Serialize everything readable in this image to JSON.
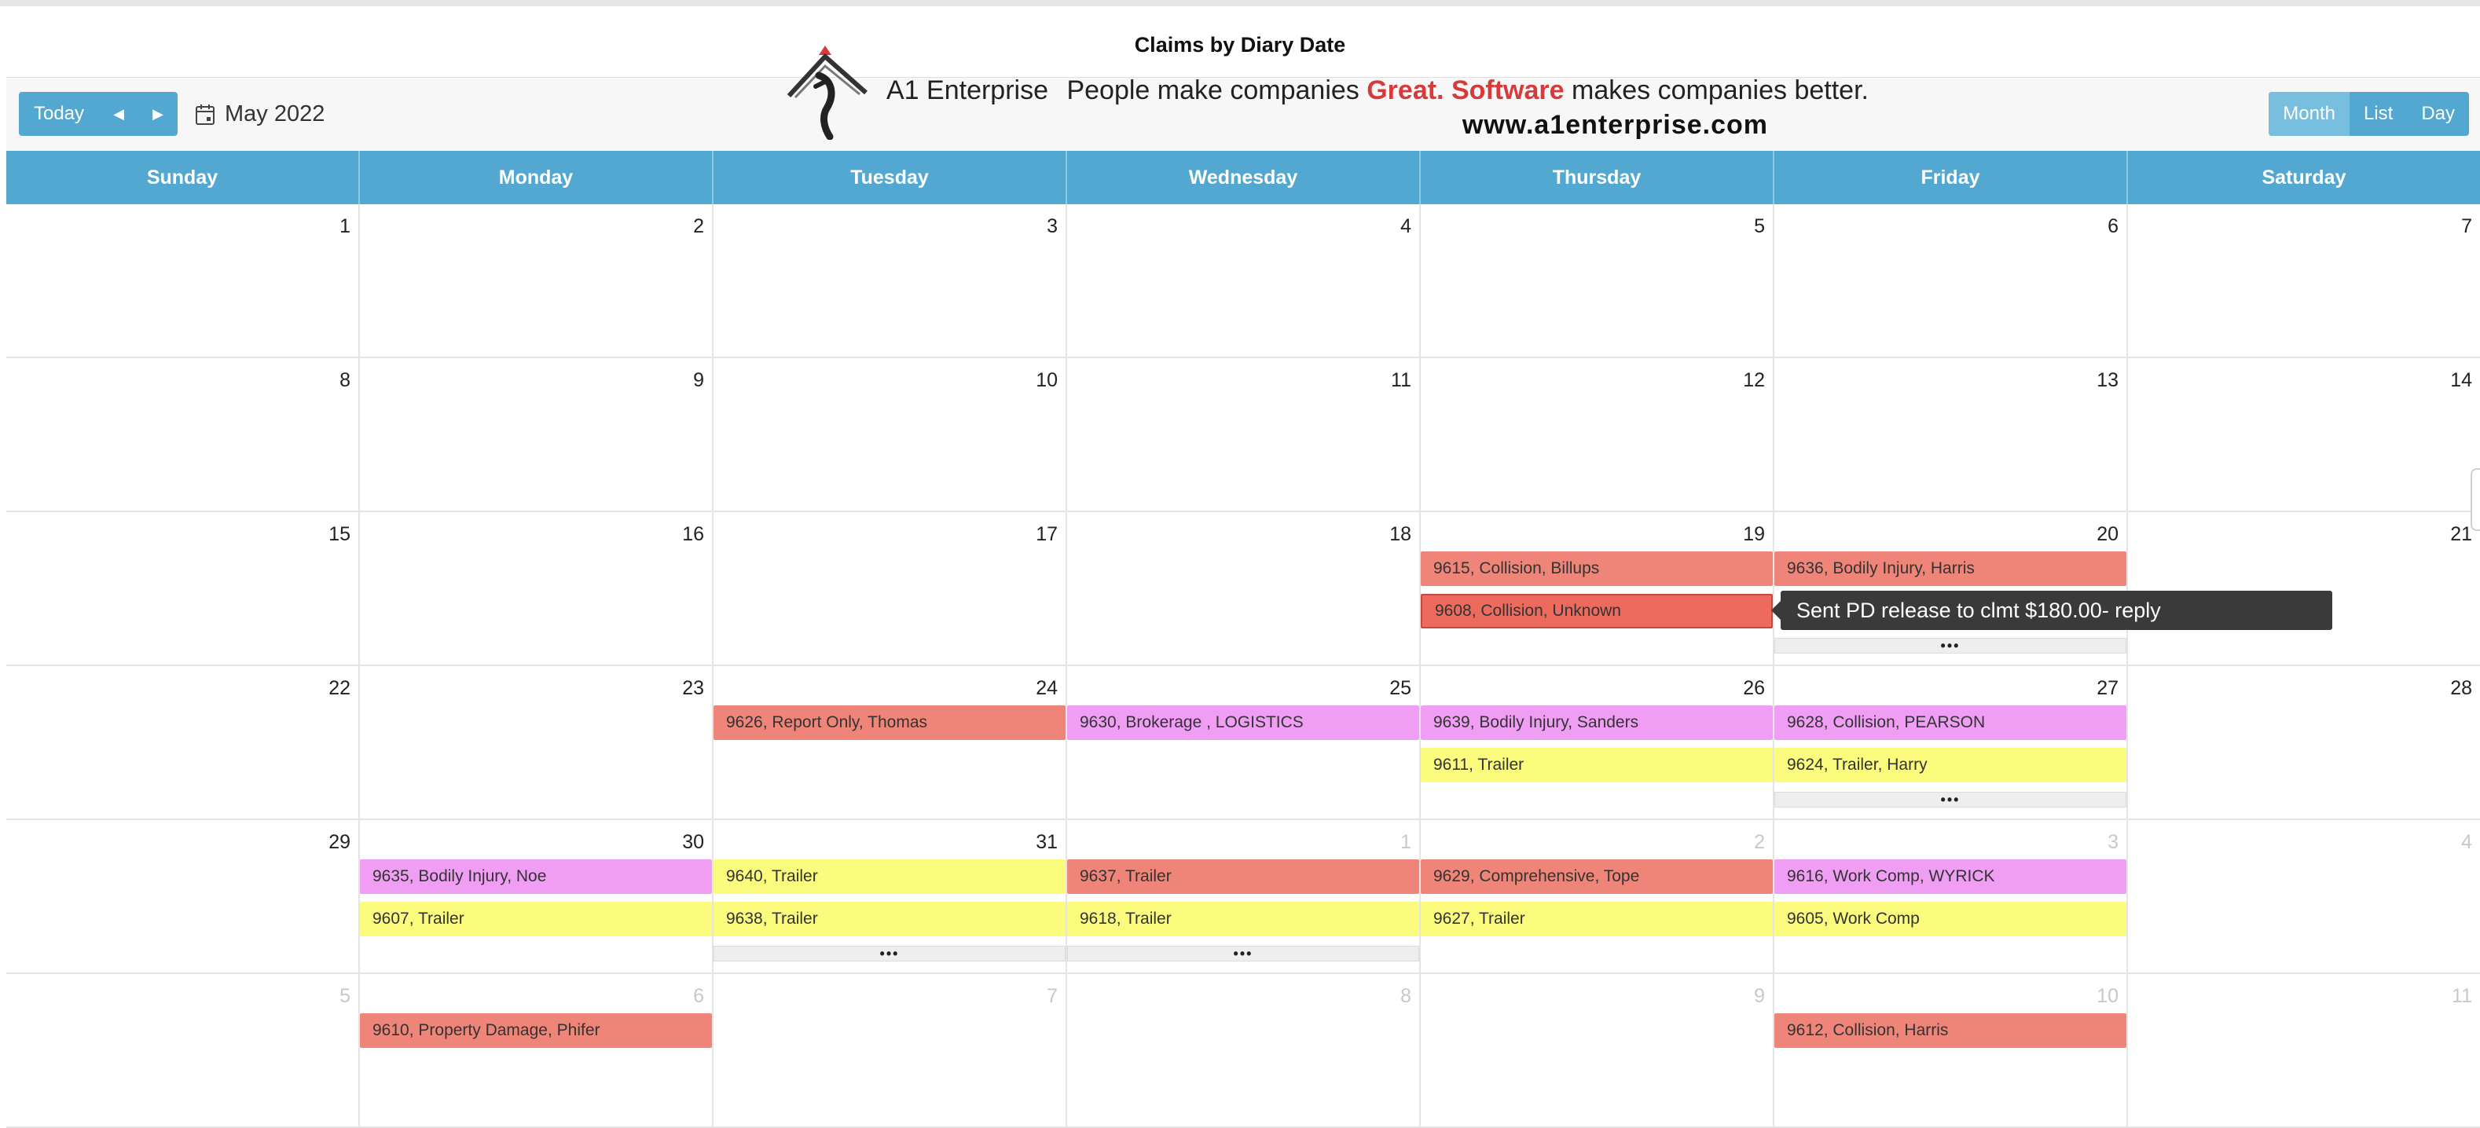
{
  "title": "Claims by Diary Date",
  "toolbar": {
    "today_label": "Today",
    "prev_icon": "◀",
    "next_icon": "▶",
    "current_month": "May 2022",
    "views": [
      "Month",
      "List",
      "Day"
    ],
    "active_view": "Month"
  },
  "logo": {
    "brand": "A1 Enterprise",
    "tagline_start": "People make companies",
    "tagline_highlight": "Great. Software",
    "tagline_end": "makes companies better.",
    "url": "www.a1enterprise.com"
  },
  "colors": {
    "header": "#52a8d0",
    "event_red": "#ef8578",
    "event_red_selected": "#ec6b5e",
    "event_pink": "#f09ef4",
    "event_yellow": "#fbfb7d",
    "highlight": "#d83a3a"
  },
  "weekdays": [
    "Sunday",
    "Monday",
    "Tuesday",
    "Wednesday",
    "Thursday",
    "Friday",
    "Saturday"
  ],
  "weeks": [
    [
      {
        "day": "1",
        "other": false,
        "events": [],
        "more": false
      },
      {
        "day": "2",
        "other": false,
        "events": [],
        "more": false
      },
      {
        "day": "3",
        "other": false,
        "events": [],
        "more": false
      },
      {
        "day": "4",
        "other": false,
        "events": [],
        "more": false
      },
      {
        "day": "5",
        "other": false,
        "events": [],
        "more": false
      },
      {
        "day": "6",
        "other": false,
        "events": [],
        "more": false
      },
      {
        "day": "7",
        "other": false,
        "events": [],
        "more": false
      }
    ],
    [
      {
        "day": "8",
        "other": false,
        "events": [],
        "more": false
      },
      {
        "day": "9",
        "other": false,
        "events": [],
        "more": false
      },
      {
        "day": "10",
        "other": false,
        "events": [],
        "more": false
      },
      {
        "day": "11",
        "other": false,
        "events": [],
        "more": false
      },
      {
        "day": "12",
        "other": false,
        "events": [],
        "more": false
      },
      {
        "day": "13",
        "other": false,
        "events": [],
        "more": false
      },
      {
        "day": "14",
        "other": false,
        "events": [],
        "more": false
      }
    ],
    [
      {
        "day": "15",
        "other": false,
        "events": [],
        "more": false
      },
      {
        "day": "16",
        "other": false,
        "events": [],
        "more": false
      },
      {
        "day": "17",
        "other": false,
        "events": [],
        "more": false
      },
      {
        "day": "18",
        "other": false,
        "events": [],
        "more": false
      },
      {
        "day": "19",
        "other": false,
        "events": [
          {
            "label": "9615, Collision, Billups",
            "color": "red"
          },
          {
            "label": "9608, Collision, Unknown",
            "color": "red",
            "selected": true
          }
        ],
        "more": false
      },
      {
        "day": "20",
        "other": false,
        "events": [
          {
            "label": "9636, Bodily Injury, Harris",
            "color": "red"
          }
        ],
        "more": true
      },
      {
        "day": "21",
        "other": false,
        "events": [],
        "more": false
      }
    ],
    [
      {
        "day": "22",
        "other": false,
        "events": [],
        "more": false
      },
      {
        "day": "23",
        "other": false,
        "events": [],
        "more": false
      },
      {
        "day": "24",
        "other": false,
        "events": [
          {
            "label": "9626, Report Only, Thomas",
            "color": "red"
          }
        ],
        "more": false
      },
      {
        "day": "25",
        "other": false,
        "events": [
          {
            "label": "9630, Brokerage , LOGISTICS",
            "color": "pink"
          }
        ],
        "more": false
      },
      {
        "day": "26",
        "other": false,
        "events": [
          {
            "label": "9639, Bodily Injury, Sanders",
            "color": "pink"
          },
          {
            "label": "9611, Trailer",
            "color": "yellow"
          }
        ],
        "more": false
      },
      {
        "day": "27",
        "other": false,
        "events": [
          {
            "label": "9628, Collision, PEARSON",
            "color": "pink"
          },
          {
            "label": "9624, Trailer, Harry",
            "color": "yellow"
          }
        ],
        "more": true
      },
      {
        "day": "28",
        "other": false,
        "events": [],
        "more": false
      }
    ],
    [
      {
        "day": "29",
        "other": false,
        "events": [],
        "more": false
      },
      {
        "day": "30",
        "other": false,
        "events": [
          {
            "label": "9635, Bodily Injury, Noe",
            "color": "pink"
          },
          {
            "label": "9607, Trailer",
            "color": "yellow"
          }
        ],
        "more": false
      },
      {
        "day": "31",
        "other": false,
        "events": [
          {
            "label": "9640, Trailer",
            "color": "yellow"
          },
          {
            "label": "9638, Trailer",
            "color": "yellow"
          }
        ],
        "more": true
      },
      {
        "day": "1",
        "other": true,
        "events": [
          {
            "label": "9637, Trailer",
            "color": "red"
          },
          {
            "label": "9618, Trailer",
            "color": "yellow"
          }
        ],
        "more": true
      },
      {
        "day": "2",
        "other": true,
        "events": [
          {
            "label": "9629, Comprehensive, Tope",
            "color": "red"
          },
          {
            "label": "9627, Trailer",
            "color": "yellow"
          }
        ],
        "more": false
      },
      {
        "day": "3",
        "other": true,
        "events": [
          {
            "label": "9616, Work Comp, WYRICK",
            "color": "pink"
          },
          {
            "label": "9605, Work Comp",
            "color": "yellow"
          }
        ],
        "more": false
      },
      {
        "day": "4",
        "other": true,
        "events": [],
        "more": false
      }
    ],
    [
      {
        "day": "5",
        "other": true,
        "events": [],
        "more": false
      },
      {
        "day": "6",
        "other": true,
        "events": [
          {
            "label": "9610, Property Damage, Phifer",
            "color": "red"
          }
        ],
        "more": false
      },
      {
        "day": "7",
        "other": true,
        "events": [],
        "more": false
      },
      {
        "day": "8",
        "other": true,
        "events": [],
        "more": false
      },
      {
        "day": "9",
        "other": true,
        "events": [],
        "more": false
      },
      {
        "day": "10",
        "other": true,
        "events": [
          {
            "label": "9612, Collision, Harris",
            "color": "red"
          }
        ],
        "more": false
      },
      {
        "day": "11",
        "other": true,
        "events": [],
        "more": false
      }
    ]
  ],
  "more_label": "•••",
  "tooltip": "Sent PD release to clmt $180.00- reply"
}
